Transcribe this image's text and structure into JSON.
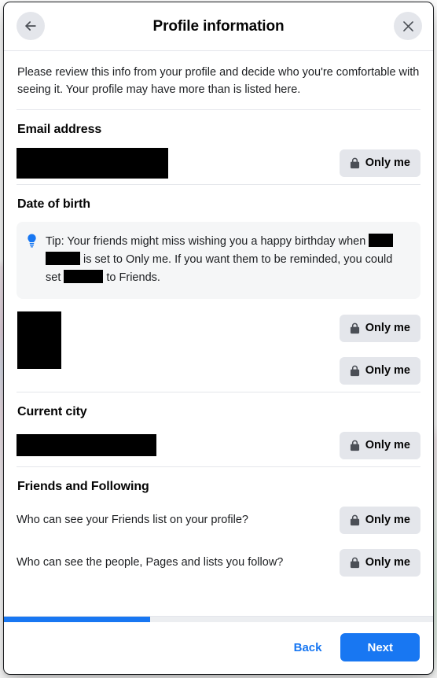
{
  "modal": {
    "title": "Profile information",
    "back_icon": "arrow-left-icon",
    "close_icon": "close-icon",
    "intro": "Please review this info from your profile and decide who you're comfortable with seeing it. Your profile may have more than is listed here."
  },
  "sections": {
    "email": {
      "title": "Email address",
      "value_redacted": true,
      "privacy_label": "Only me",
      "privacy_icon": "lock-icon"
    },
    "dob": {
      "title": "Date of birth",
      "tip_icon": "lightbulb-icon",
      "tip_text_part1": "Tip: Your friends might miss wishing you a happy birthday when",
      "tip_text_part2": "is set to Only me. If you want them to be reminded, you could set",
      "tip_text_part3": "to Friends.",
      "privacy_label_date": "Only me",
      "privacy_label_year": "Only me",
      "privacy_icon": "lock-icon"
    },
    "current_city": {
      "title": "Current city",
      "value_redacted": true,
      "privacy_label": "Only me",
      "privacy_icon": "lock-icon"
    },
    "friends_following": {
      "title": "Friends and Following",
      "rows": [
        {
          "label": "Who can see your Friends list on your profile?",
          "privacy_label": "Only me",
          "privacy_icon": "lock-icon"
        },
        {
          "label": "Who can see the people, Pages and lists you follow?",
          "privacy_label": "Only me",
          "privacy_icon": "lock-icon"
        }
      ]
    }
  },
  "footer": {
    "progress_percent": 34,
    "back_label": "Back",
    "next_label": "Next"
  },
  "colors": {
    "accent": "#1877f2",
    "pill_bg": "#e4e6eb",
    "tip_bg": "#f5f6f7",
    "divider": "#e4e6eb",
    "text_primary": "#050505",
    "redaction": "#000000"
  }
}
